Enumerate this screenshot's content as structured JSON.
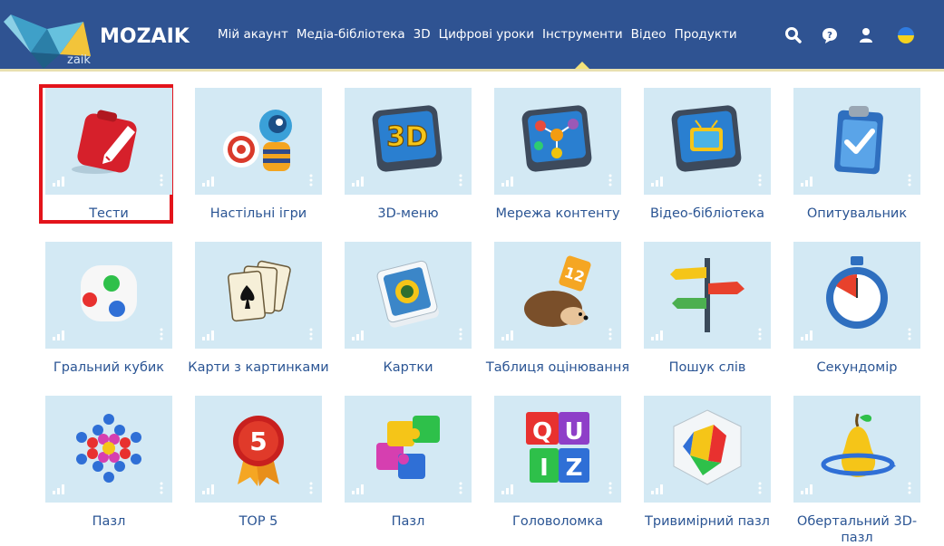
{
  "header": {
    "logo_text": "MOZAIK",
    "bird_caption": "zaik",
    "nav": [
      "Мій акаунт",
      "Медіа-бібліотека",
      "3D",
      "Цифрові уроки",
      "Інструменти",
      "Відео",
      "Продукти"
    ],
    "active_nav": "Інструменти",
    "icons": [
      "search-icon",
      "help-chat-icon",
      "user-icon",
      "ukraine-flag-icon"
    ]
  },
  "tools": [
    {
      "label": "Тести",
      "icon": "red-pencil-notepad-icon",
      "selected": true
    },
    {
      "label": "Настільні ігри",
      "icon": "target-robot-icon"
    },
    {
      "label": "3D-меню",
      "icon": "3d-tv-icon"
    },
    {
      "label": "Мережа контенту",
      "icon": "content-network-icon"
    },
    {
      "label": "Відео-бібліотека",
      "icon": "video-tv-icon"
    },
    {
      "label": "Опитувальник",
      "icon": "clipboard-check-icon"
    },
    {
      "label": "Гральний кубик",
      "icon": "dice-icon"
    },
    {
      "label": "Карти з картинками",
      "icon": "playing-cards-icon"
    },
    {
      "label": "Картки",
      "icon": "card-deck-icon"
    },
    {
      "label": "Таблиця оцінювання",
      "icon": "hedgehog-cards-icon"
    },
    {
      "label": "Пошук слів",
      "icon": "signpost-icon"
    },
    {
      "label": "Секундомір",
      "icon": "stopwatch-icon"
    },
    {
      "label": "Пазл",
      "icon": "hex-puzzle-icon"
    },
    {
      "label": "TOP 5",
      "icon": "top5-badge-icon"
    },
    {
      "label": "Пазл",
      "icon": "jigsaw-icon"
    },
    {
      "label": "Головоломка",
      "icon": "quiz-cubes-icon"
    },
    {
      "label": "Тривимірний пазл",
      "icon": "3d-shapes-icon"
    },
    {
      "label": "Обертальний 3D-пазл",
      "icon": "rotating-pear-icon"
    }
  ],
  "colors": {
    "header": "#2f5392",
    "tile": "#d3e9f4",
    "label": "#2b5594",
    "selection": "#e3141b"
  }
}
